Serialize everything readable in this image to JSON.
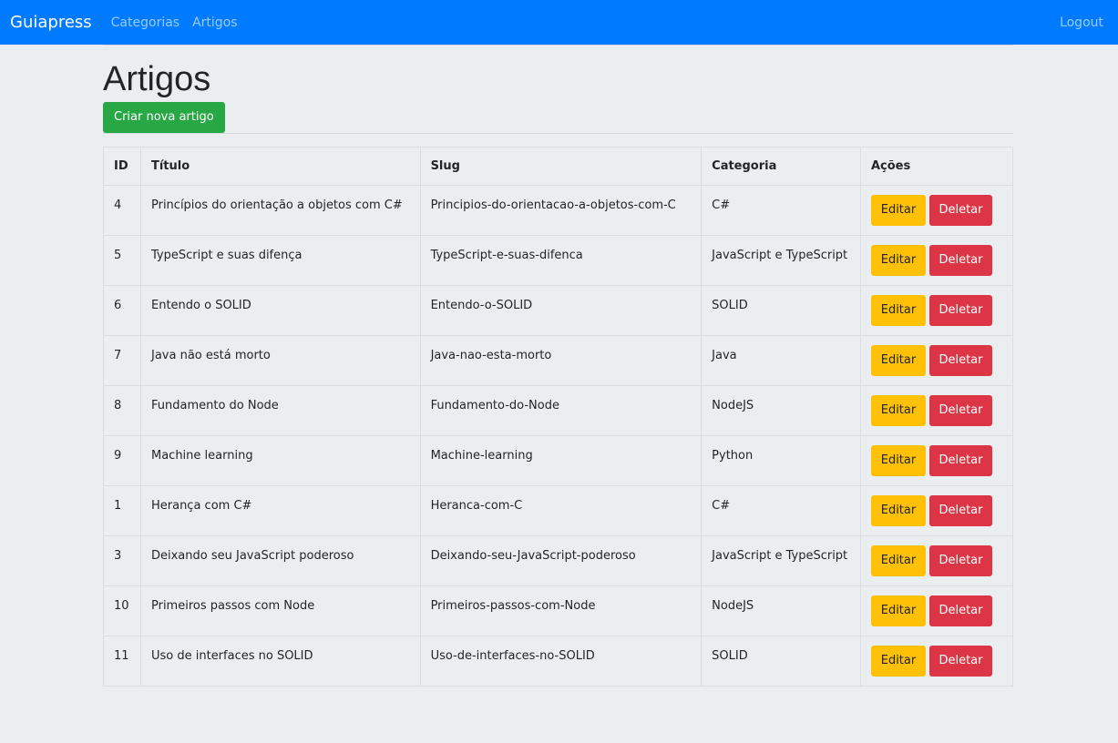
{
  "navbar": {
    "brand": "Guiapress",
    "links": [
      "Categorias",
      "Artigos"
    ],
    "logout": "Logout"
  },
  "page": {
    "title": "Artigos",
    "create_button": "Criar nova artigo"
  },
  "table": {
    "headers": [
      "ID",
      "Título",
      "Slug",
      "Categoria",
      "Ações"
    ],
    "actions": {
      "edit": "Editar",
      "delete": "Deletar"
    },
    "rows": [
      {
        "id": "4",
        "titulo": "Princípios do orientação a objetos com C#",
        "slug": "Principios-do-orientacao-a-objetos-com-C",
        "categoria": "C#"
      },
      {
        "id": "5",
        "titulo": "TypeScript e suas difença",
        "slug": "TypeScript-e-suas-difenca",
        "categoria": "JavaScript e TypeScript"
      },
      {
        "id": "6",
        "titulo": "Entendo o SOLID",
        "slug": "Entendo-o-SOLID",
        "categoria": "SOLID"
      },
      {
        "id": "7",
        "titulo": "Java não está morto",
        "slug": "Java-nao-esta-morto",
        "categoria": "Java"
      },
      {
        "id": "8",
        "titulo": "Fundamento do Node",
        "slug": "Fundamento-do-Node",
        "categoria": "NodeJS"
      },
      {
        "id": "9",
        "titulo": "Machine learning",
        "slug": "Machine-learning",
        "categoria": "Python"
      },
      {
        "id": "1",
        "titulo": "Herança com C#",
        "slug": "Heranca-com-C",
        "categoria": "C#"
      },
      {
        "id": "3",
        "titulo": "Deixando seu JavaScript poderoso",
        "slug": "Deixando-seu-JavaScript-poderoso",
        "categoria": "JavaScript e TypeScript"
      },
      {
        "id": "10",
        "titulo": "Primeiros passos com Node",
        "slug": "Primeiros-passos-com-Node",
        "categoria": "NodeJS"
      },
      {
        "id": "11",
        "titulo": "Uso de interfaces no SOLID",
        "slug": "Uso-de-interfaces-no-SOLID",
        "categoria": "SOLID"
      }
    ]
  },
  "colors": {
    "navbar": "#007bff",
    "success": "#28a745",
    "warning": "#ffc107",
    "danger": "#dc3545",
    "background": "#ebeef1"
  }
}
